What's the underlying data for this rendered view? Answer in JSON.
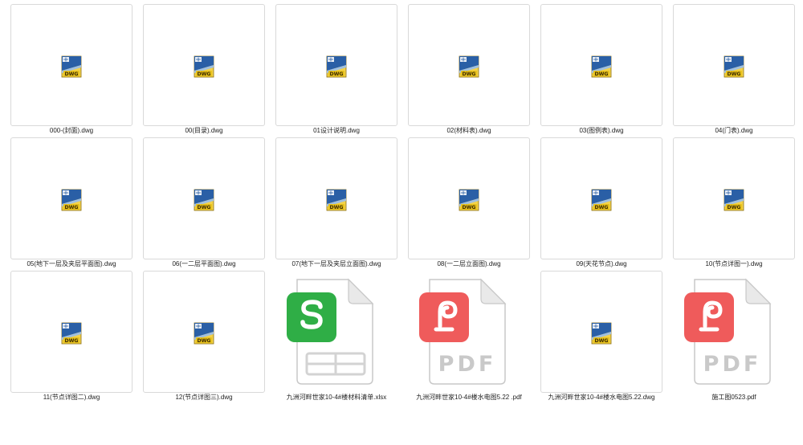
{
  "files": [
    {
      "name": "000-(封面).dwg",
      "type": "dwg",
      "icon": "dwg-file-icon"
    },
    {
      "name": "00(目录).dwg",
      "type": "dwg",
      "icon": "dwg-file-icon"
    },
    {
      "name": "01设计说明.dwg",
      "type": "dwg",
      "icon": "dwg-file-icon"
    },
    {
      "name": "02(材料表).dwg",
      "type": "dwg",
      "icon": "dwg-file-icon"
    },
    {
      "name": "03(图例表).dwg",
      "type": "dwg",
      "icon": "dwg-file-icon"
    },
    {
      "name": "04(门表).dwg",
      "type": "dwg",
      "icon": "dwg-file-icon"
    },
    {
      "name": "05(地下一层及夹层平面图).dwg",
      "type": "dwg",
      "icon": "dwg-file-icon"
    },
    {
      "name": "06(一二层平面图).dwg",
      "type": "dwg",
      "icon": "dwg-file-icon"
    },
    {
      "name": "07(地下一层及夹层立面图).dwg",
      "type": "dwg",
      "icon": "dwg-file-icon"
    },
    {
      "name": "08(一二层立面图).dwg",
      "type": "dwg",
      "icon": "dwg-file-icon"
    },
    {
      "name": "09(天花节点).dwg",
      "type": "dwg",
      "icon": "dwg-file-icon"
    },
    {
      "name": "10(节点详图一).dwg",
      "type": "dwg",
      "icon": "dwg-file-icon"
    },
    {
      "name": "11(节点详图二).dwg",
      "type": "dwg",
      "icon": "dwg-file-icon"
    },
    {
      "name": "12(节点详图三).dwg",
      "type": "dwg",
      "icon": "dwg-file-icon"
    },
    {
      "name": "九洲河畔世家10-4#楼材料清单.xlsx",
      "type": "xlsx",
      "icon": "spreadsheet-file-icon"
    },
    {
      "name": "九洲河畔世家10-4#楼水电图5.22 .pdf",
      "type": "pdf",
      "icon": "pdf-file-icon",
      "label": "PDF"
    },
    {
      "name": "九洲河畔世家10-4#楼水电图5.22.dwg",
      "type": "dwg",
      "icon": "dwg-file-icon"
    },
    {
      "name": "施工图0523.pdf",
      "type": "pdf",
      "icon": "pdf-file-icon",
      "label": "PDF"
    }
  ],
  "icon_badge_text": "DWG",
  "colors": {
    "xlsx_accent": "#2fae46",
    "pdf_accent": "#ef5b5b",
    "dwg_yellow": "#e8c21c",
    "dwg_blue": "#1d4f8c",
    "tile_border": "#d9d9d9"
  }
}
